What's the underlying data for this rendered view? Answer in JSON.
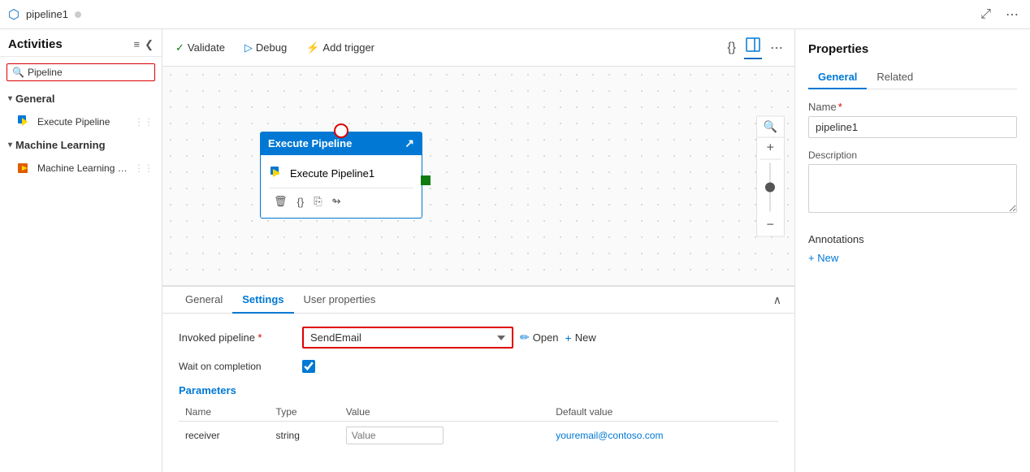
{
  "titleBar": {
    "icon": "⬡",
    "name": "pipeline1",
    "moreBtn": "⋯",
    "expandBtn": "⤢"
  },
  "toolbar": {
    "validate": "Validate",
    "debug": "Debug",
    "addTrigger": "Add trigger",
    "jsonBtn": "{}",
    "moreBtn": "⋯"
  },
  "sidebar": {
    "title": "Activities",
    "searchPlaceholder": "Pipeline",
    "collapseIcon": "❮",
    "filterIcon": "≡",
    "sections": [
      {
        "label": "General",
        "items": [
          {
            "label": "Execute Pipeline",
            "icon": "execute"
          }
        ]
      },
      {
        "label": "Machine Learning",
        "items": [
          {
            "label": "Machine Learning Exe...",
            "icon": "ml"
          }
        ]
      }
    ]
  },
  "canvas": {
    "nodeTitle": "Execute Pipeline",
    "activityLabel": "Execute Pipeline1"
  },
  "bottomPanel": {
    "tabs": [
      "General",
      "Settings",
      "User properties"
    ],
    "activeTab": "Settings",
    "invokedPipelineLabel": "Invoked pipeline",
    "invokedPipelineRequired": "*",
    "invokedPipelineValue": "SendEmail",
    "openBtn": "Open",
    "newBtn": "New",
    "waitOnCompletion": "Wait on completion",
    "parametersTitle": "Parameters",
    "paramsHeaders": [
      "Name",
      "Type",
      "Value",
      "Default value"
    ],
    "params": [
      {
        "name": "receiver",
        "type": "string",
        "valuePlaceholder": "Value",
        "defaultValue": "youremail@contoso.com"
      }
    ]
  },
  "properties": {
    "title": "Properties",
    "tabs": [
      "General",
      "Related"
    ],
    "activeTab": "General",
    "nameLabel": "Name",
    "nameRequired": "*",
    "nameValue": "pipeline1",
    "descriptionLabel": "Description",
    "descriptionValue": "",
    "annotationsLabel": "Annotations",
    "annotationsAddBtn": "+ New"
  }
}
